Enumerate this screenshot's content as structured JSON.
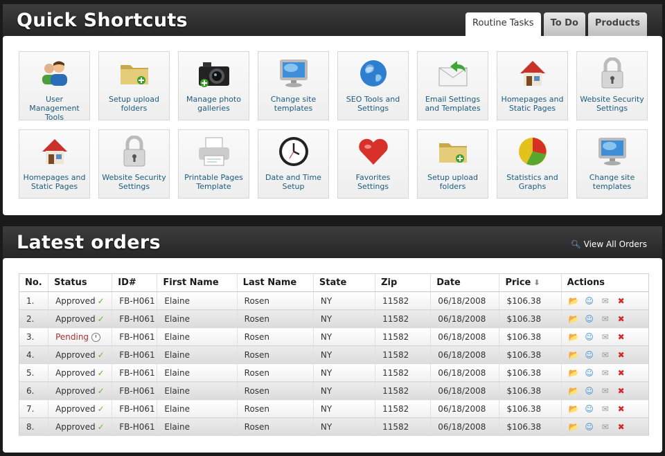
{
  "shortcuts": {
    "title": "Quick Shortcuts",
    "tabs": [
      {
        "label": "Routine Tasks",
        "active": true
      },
      {
        "label": "To Do",
        "active": false
      },
      {
        "label": "Products",
        "active": false
      }
    ],
    "tiles": [
      {
        "label": "User Management Tools",
        "icon": "users-icon"
      },
      {
        "label": "Setup upload folders",
        "icon": "folder-add-icon"
      },
      {
        "label": "Manage photo galleries",
        "icon": "camera-icon"
      },
      {
        "label": "Change site templates",
        "icon": "monitor-icon"
      },
      {
        "label": "SEO Tools and Settings",
        "icon": "globe-icon"
      },
      {
        "label": "Email Settings and Templates",
        "icon": "email-reply-icon"
      },
      {
        "label": "Homepages and Static Pages",
        "icon": "house-icon"
      },
      {
        "label": "Website Security Settings",
        "icon": "padlock-icon"
      },
      {
        "label": "Homepages and Static Pages",
        "icon": "house-icon"
      },
      {
        "label": "Website Security Settings",
        "icon": "padlock-icon"
      },
      {
        "label": "Printable Pages Template",
        "icon": "printer-icon"
      },
      {
        "label": "Date and Time Setup",
        "icon": "clock-icon"
      },
      {
        "label": "Favorites Settings",
        "icon": "heart-icon"
      },
      {
        "label": "Setup upload folders",
        "icon": "folder-add-icon"
      },
      {
        "label": "Statistics and Graphs",
        "icon": "pie-chart-icon"
      },
      {
        "label": "Change site templates",
        "icon": "monitor-icon"
      }
    ]
  },
  "orders": {
    "title": "Latest orders",
    "view_all_label": "View All Orders",
    "columns": [
      "No.",
      "Status",
      "ID#",
      "First Name",
      "Last Name",
      "State",
      "Zip",
      "Date",
      "Price",
      "Actions"
    ],
    "rows": [
      {
        "no": "1.",
        "status": "Approved",
        "id": "FB-H061",
        "first": "Elaine",
        "last": "Rosen",
        "state": "NY",
        "zip": "11582",
        "date": "06/18/2008",
        "price": "$106.38"
      },
      {
        "no": "2.",
        "status": "Approved",
        "id": "FB-H061",
        "first": "Elaine",
        "last": "Rosen",
        "state": "NY",
        "zip": "11582",
        "date": "06/18/2008",
        "price": "$106.38"
      },
      {
        "no": "3.",
        "status": "Pending",
        "id": "FB-H061",
        "first": "Elaine",
        "last": "Rosen",
        "state": "NY",
        "zip": "11582",
        "date": "06/18/2008",
        "price": "$106.38"
      },
      {
        "no": "4.",
        "status": "Approved",
        "id": "FB-H061",
        "first": "Elaine",
        "last": "Rosen",
        "state": "NY",
        "zip": "11582",
        "date": "06/18/2008",
        "price": "$106.38"
      },
      {
        "no": "5.",
        "status": "Approved",
        "id": "FB-H061",
        "first": "Elaine",
        "last": "Rosen",
        "state": "NY",
        "zip": "11582",
        "date": "06/18/2008",
        "price": "$106.38"
      },
      {
        "no": "6.",
        "status": "Approved",
        "id": "FB-H061",
        "first": "Elaine",
        "last": "Rosen",
        "state": "NY",
        "zip": "11582",
        "date": "06/18/2008",
        "price": "$106.38"
      },
      {
        "no": "7.",
        "status": "Approved",
        "id": "FB-H061",
        "first": "Elaine",
        "last": "Rosen",
        "state": "NY",
        "zip": "11582",
        "date": "06/18/2008",
        "price": "$106.38"
      },
      {
        "no": "8.",
        "status": "Approved",
        "id": "FB-H061",
        "first": "Elaine",
        "last": "Rosen",
        "state": "NY",
        "zip": "11582",
        "date": "06/18/2008",
        "price": "$106.38"
      }
    ],
    "actions": [
      "open-folder-icon",
      "user-icon",
      "email-icon",
      "delete-icon"
    ]
  }
}
